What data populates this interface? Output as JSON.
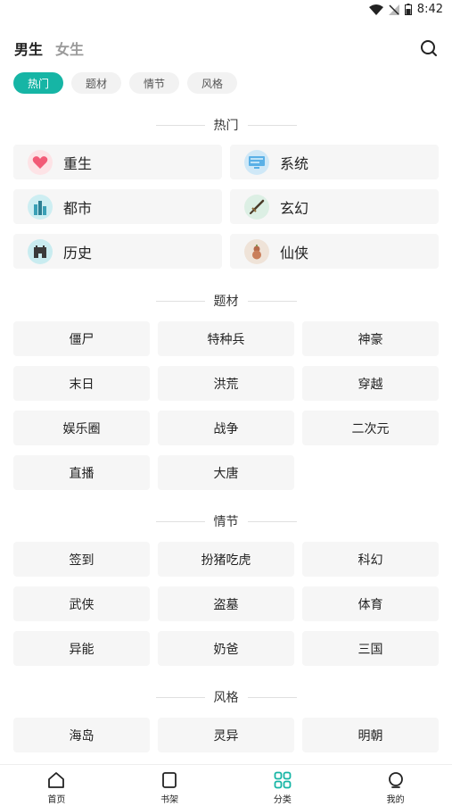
{
  "status_bar": {
    "time": "8:42"
  },
  "header": {
    "tab_male": "男生",
    "tab_female": "女生"
  },
  "chips": [
    "热门",
    "题材",
    "情节",
    "风格"
  ],
  "sections": {
    "hot": "热门",
    "theme": "题材",
    "plot": "情节",
    "style": "风格"
  },
  "hot_items": [
    {
      "label": "重生",
      "icon": "heart-icon",
      "color": "#fde3e6"
    },
    {
      "label": "系统",
      "icon": "screen-icon",
      "color": "#cfe8f7"
    },
    {
      "label": "都市",
      "icon": "city-icon",
      "color": "#cdeef2"
    },
    {
      "label": "玄幻",
      "icon": "sword-icon",
      "color": "#dcefe4"
    },
    {
      "label": "历史",
      "icon": "tower-icon",
      "color": "#c9ecf0"
    },
    {
      "label": "仙侠",
      "icon": "gourd-icon",
      "color": "#efe3d8"
    }
  ],
  "theme_tags": [
    "僵尸",
    "特种兵",
    "神豪",
    "末日",
    "洪荒",
    "穿越",
    "娱乐圈",
    "战争",
    "二次元",
    "直播",
    "大唐"
  ],
  "plot_tags": [
    "签到",
    "扮猪吃虎",
    "科幻",
    "武侠",
    "盗墓",
    "体育",
    "异能",
    "奶爸",
    "三国"
  ],
  "style_tags": [
    "海岛",
    "灵异",
    "明朝"
  ],
  "bottom_nav": [
    {
      "label": "首页",
      "icon": "home-icon"
    },
    {
      "label": "书架",
      "icon": "bookshelf-icon"
    },
    {
      "label": "分类",
      "icon": "category-icon"
    },
    {
      "label": "我的",
      "icon": "profile-icon"
    }
  ],
  "colors": {
    "accent": "#16b5a5"
  }
}
